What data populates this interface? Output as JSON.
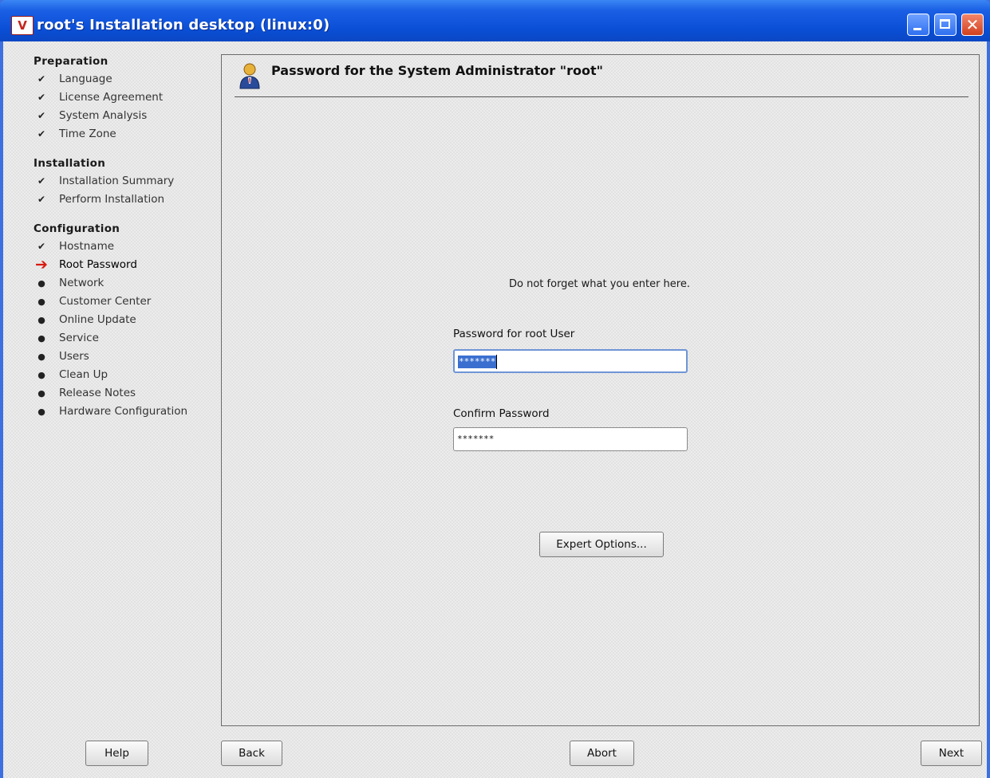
{
  "window": {
    "icon_label": "V",
    "title": "root's Installation desktop (linux:0)"
  },
  "sidebar": {
    "sections": [
      {
        "title": "Preparation",
        "steps": [
          {
            "label": "Language",
            "state": "done"
          },
          {
            "label": "License Agreement",
            "state": "done"
          },
          {
            "label": "System Analysis",
            "state": "done"
          },
          {
            "label": "Time Zone",
            "state": "done"
          }
        ]
      },
      {
        "title": "Installation",
        "steps": [
          {
            "label": "Installation Summary",
            "state": "done"
          },
          {
            "label": "Perform Installation",
            "state": "done"
          }
        ]
      },
      {
        "title": "Configuration",
        "steps": [
          {
            "label": "Hostname",
            "state": "done"
          },
          {
            "label": "Root Password",
            "state": "current"
          },
          {
            "label": "Network",
            "state": "pending"
          },
          {
            "label": "Customer Center",
            "state": "pending"
          },
          {
            "label": "Online Update",
            "state": "pending"
          },
          {
            "label": "Service",
            "state": "pending"
          },
          {
            "label": "Users",
            "state": "pending"
          },
          {
            "label": "Clean Up",
            "state": "pending"
          },
          {
            "label": "Release Notes",
            "state": "pending"
          },
          {
            "label": "Hardware Configuration",
            "state": "pending"
          }
        ]
      }
    ]
  },
  "main": {
    "title": "Password for the System Administrator \"root\"",
    "hint": "Do not forget what you enter here.",
    "password_label": "Password for root User",
    "password_value": "*******",
    "confirm_label": "Confirm Password",
    "confirm_value": "*******",
    "expert_button": "Expert Options..."
  },
  "buttons": {
    "help": "Help",
    "back": "Back",
    "abort": "Abort",
    "next": "Next"
  },
  "colors": {
    "titlebar": "#0a4fd6",
    "current_arrow": "#d81a10",
    "selection": "#3a6fd0"
  },
  "icons": {
    "done": "checkmark-icon",
    "current": "red-arrow-icon",
    "pending": "bullet-icon",
    "header": "admin-user-icon"
  }
}
